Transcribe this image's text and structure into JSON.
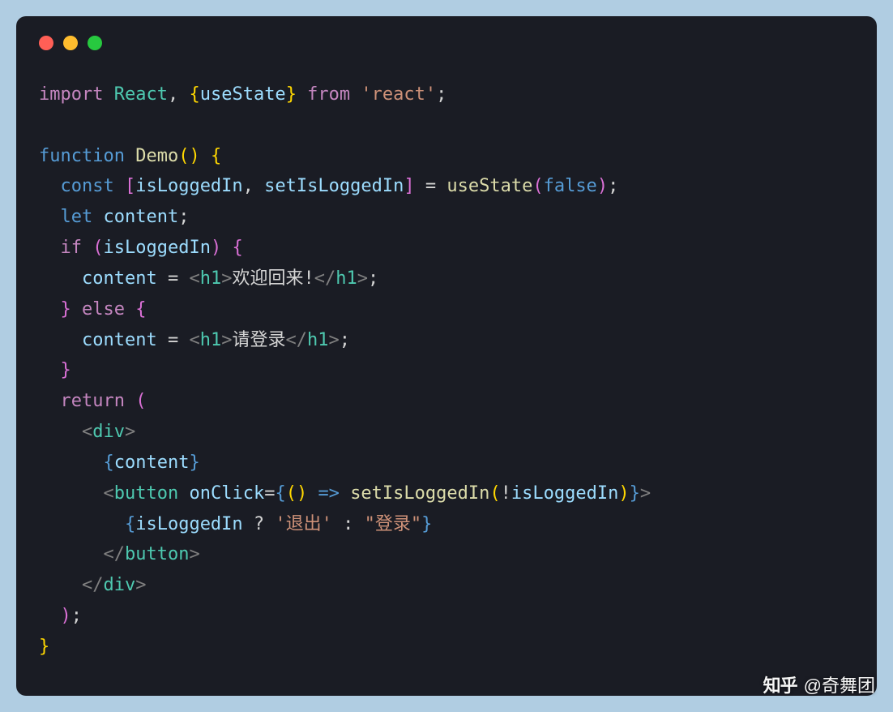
{
  "colors": {
    "background": "#b0cde2",
    "window": "#1a1c24",
    "red": "#ff5f56",
    "yellow": "#ffbd2e",
    "green": "#27c93f"
  },
  "code": {
    "l1_import": "import",
    "l1_react": "React",
    "l1_comma": ", ",
    "l1_ob": "{",
    "l1_usestate": "useState",
    "l1_cb": "}",
    "l1_from": " from ",
    "l1_str": "'react'",
    "l1_semi": ";",
    "l3_function": "function",
    "l3_demo": " Demo",
    "l3_paren": "(",
    "l3_paren2": ") ",
    "l3_brace": "{",
    "l4_const": "  const ",
    "l4_ob": "[",
    "l4_v1": "isLoggedIn",
    "l4_c": ", ",
    "l4_v2": "setIsLoggedIn",
    "l4_cb": "] ",
    "l4_eq": "= ",
    "l4_fn": "useState",
    "l4_po": "(",
    "l4_false": "false",
    "l4_pc": ")",
    "l4_semi": ";",
    "l5_let": "  let ",
    "l5_content": "content",
    "l5_semi": ";",
    "l6_if": "  if ",
    "l6_po": "(",
    "l6_var": "isLoggedIn",
    "l6_pc": ") ",
    "l6_bo": "{",
    "l7_pad": "    ",
    "l7_var": "content",
    "l7_eq": " = ",
    "l7_to": "<",
    "l7_tag": "h1",
    "l7_tc": ">",
    "l7_txt": "欢迎回来!",
    "l7_tco": "</",
    "l7_tag2": "h1",
    "l7_tcc": ">",
    "l7_semi": ";",
    "l8_cb": "  } ",
    "l8_else": "else",
    "l8_ob": " {",
    "l9_pad": "    ",
    "l9_var": "content",
    "l9_eq": " = ",
    "l9_to": "<",
    "l9_tag": "h1",
    "l9_tc": ">",
    "l9_txt": "请登录",
    "l9_tco": "</",
    "l9_tag2": "h1",
    "l9_tcc": ">",
    "l9_semi": ";",
    "l10_cb": "  }",
    "l11_ret": "  return ",
    "l11_po": "(",
    "l12_pad": "    ",
    "l12_to": "<",
    "l12_tag": "div",
    "l12_tc": ">",
    "l13_pad": "      ",
    "l13_bo": "{",
    "l13_var": "content",
    "l13_bc": "}",
    "l14_pad": "      ",
    "l14_to": "<",
    "l14_tag": "button",
    "l14_sp": " ",
    "l14_attr": "onClick",
    "l14_eq": "=",
    "l14_bo": "{",
    "l14_po": "(",
    "l14_pc": ") ",
    "l14_arrow": "=>",
    "l14_sp2": " ",
    "l14_fn": "setIsLoggedIn",
    "l14_po2": "(",
    "l14_not": "!",
    "l14_var": "isLoggedIn",
    "l14_pc2": ")",
    "l14_bc": "}",
    "l14_tc": ">",
    "l15_pad": "        ",
    "l15_bo": "{",
    "l15_var": "isLoggedIn",
    "l15_q": " ? ",
    "l15_s1": "'退出'",
    "l15_col": " : ",
    "l15_s2": "\"登录\"",
    "l15_bc": "}",
    "l16_pad": "      ",
    "l16_to": "</",
    "l16_tag": "button",
    "l16_tc": ">",
    "l17_pad": "    ",
    "l17_to": "</",
    "l17_tag": "div",
    "l17_tc": ">",
    "l18_pad": "  ",
    "l18_pc": ")",
    "l18_semi": ";",
    "l19_cb": "}"
  },
  "watermark": {
    "logo": "知乎",
    "author": "@奇舞团"
  }
}
